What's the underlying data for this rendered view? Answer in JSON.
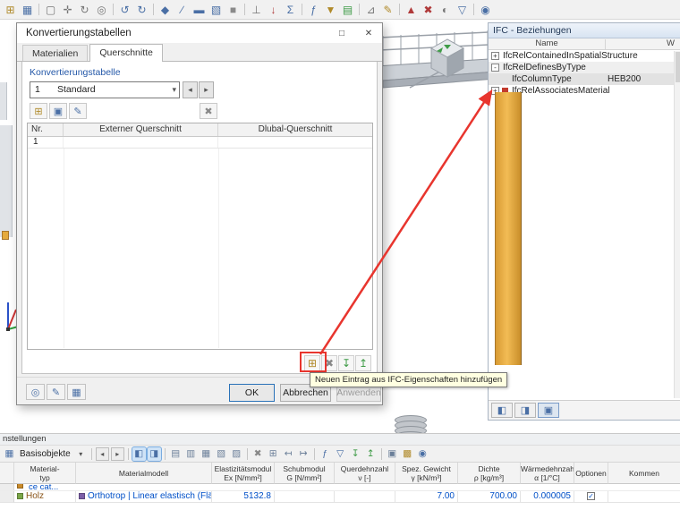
{
  "annotations": {
    "highlight_color": "#e8352e"
  },
  "colors": {
    "value_blue": "#0050c8",
    "column_orange": "#e9ab41",
    "material_chip": "#7aa648",
    "model_chip": "#7b5ea7",
    "partial_chip": "#c98a2a"
  },
  "top_toolbar": {
    "icons": [
      {
        "name": "new-model-icon",
        "glyph": "⊞",
        "color": "#b08a2a"
      },
      {
        "name": "open-model-icon",
        "glyph": "▦",
        "color": "#4a6fa5"
      },
      {
        "sep": true
      },
      {
        "name": "select-arrow-icon",
        "glyph": "▢",
        "color": "#777777"
      },
      {
        "name": "pan-icon",
        "glyph": "✛",
        "color": "#777777"
      },
      {
        "name": "rotate-view-icon",
        "glyph": "↻",
        "color": "#777777"
      },
      {
        "name": "zoom-view-icon",
        "glyph": "◎",
        "color": "#777777"
      },
      {
        "sep": true
      },
      {
        "name": "undo-icon",
        "glyph": "↺",
        "color": "#4a6fa5"
      },
      {
        "name": "redo-icon",
        "glyph": "↻",
        "color": "#4a6fa5"
      },
      {
        "sep": true
      },
      {
        "name": "node-tool-icon",
        "glyph": "◆",
        "color": "#4a6fa5"
      },
      {
        "name": "line-tool-icon",
        "glyph": "∕",
        "color": "#4a6fa5"
      },
      {
        "name": "member-tool-icon",
        "glyph": "▬",
        "color": "#4a6fa5"
      },
      {
        "name": "surface-tool-icon",
        "glyph": "▧",
        "color": "#4a6fa5"
      },
      {
        "name": "solid-tool-icon",
        "glyph": "■",
        "color": "#8a8a8a"
      },
      {
        "sep": true
      },
      {
        "name": "support-tool-icon",
        "glyph": "⊥",
        "color": "#777777"
      },
      {
        "name": "load-tool-icon",
        "glyph": "↓",
        "color": "#b03a3a"
      },
      {
        "name": "load-case-icon",
        "glyph": "Σ",
        "color": "#4a6fa5"
      },
      {
        "sep": true
      },
      {
        "name": "calculate-icon",
        "glyph": "ƒ",
        "color": "#4a6fa5"
      },
      {
        "name": "results-icon",
        "glyph": "▼",
        "color": "#b08a2a"
      },
      {
        "name": "tables-icon",
        "glyph": "▤",
        "color": "#3f9b47"
      },
      {
        "sep": true
      },
      {
        "name": "section-cut-icon",
        "glyph": "⊿",
        "color": "#777777"
      },
      {
        "name": "annotate-icon",
        "glyph": "✎",
        "color": "#b08a2a"
      },
      {
        "sep": true
      },
      {
        "name": "delete-load-icon",
        "glyph": "▲",
        "color": "#b03a3a"
      },
      {
        "name": "delete-icon",
        "glyph": "✖",
        "color": "#b03a3a"
      },
      {
        "name": "visibility-icon",
        "glyph": "◐",
        "color": "#777777"
      },
      {
        "name": "filter-icon",
        "glyph": "▽",
        "color": "#4a6fa5"
      },
      {
        "sep": true
      },
      {
        "name": "search-icon",
        "glyph": "◉",
        "color": "#4a6fa5"
      }
    ]
  },
  "dialog": {
    "title": "Konvertierungstabellen",
    "icons": {
      "maximize": "□",
      "close": "✕",
      "caret": "▾"
    },
    "tabs": [
      {
        "label": "Materialien",
        "active": false
      },
      {
        "label": "Querschnitte",
        "active": true
      }
    ],
    "group_label": "Konvertierungstabelle",
    "combo": {
      "index": "1",
      "value": "Standard"
    },
    "nav": {
      "prev": "◂",
      "next": "▸"
    },
    "table_toolbar": [
      {
        "name": "new-table-icon",
        "glyph": "⊞",
        "color": "#b08a2a"
      },
      {
        "name": "copy-table-icon",
        "glyph": "▣",
        "color": "#4a6fa5"
      },
      {
        "name": "rename-table-icon",
        "glyph": "✎",
        "color": "#4a6fa5"
      }
    ],
    "delete_table_icon": {
      "glyph": "✖",
      "color": "#888888"
    },
    "table": {
      "columns": [
        "Nr.",
        "Externer Querschnitt",
        "Dlubal-Querschnitt"
      ],
      "rows": [
        [
          "1",
          "",
          ""
        ]
      ]
    },
    "entry_buttons": [
      {
        "name": "add-from-ifc-button",
        "glyph": "⊞",
        "color": "#b08a2a"
      },
      {
        "name": "delete-entry-button",
        "glyph": "✖",
        "color": "#888888"
      },
      {
        "name": "import-entries-button",
        "glyph": "↧",
        "color": "#3f9b47"
      },
      {
        "name": "export-entries-button",
        "glyph": "↥",
        "color": "#3f9b47"
      }
    ],
    "tooltip": "Neuen Eintrag aus IFC-Eigenschaften hinzufügen",
    "footer_tools": [
      {
        "name": "details-icon",
        "glyph": "◎",
        "color": "#4a6fa5"
      },
      {
        "name": "edit-settings-icon",
        "glyph": "✎",
        "color": "#4a6fa5"
      },
      {
        "name": "manage-tables-icon",
        "glyph": "▦",
        "color": "#4a6fa5"
      }
    ],
    "footer_buttons": {
      "ok": "OK",
      "cancel": "Abbrechen",
      "apply": "Anwenden"
    }
  },
  "ifc_panel": {
    "title": "IFC - Beziehungen",
    "name_column": "Name",
    "value_column": "W",
    "rows": [
      {
        "expander": "+",
        "label": "IfcRelContainedInSpatialStructure",
        "value": ""
      },
      {
        "expander": "-",
        "label": "IfcRelDefinesByType",
        "value": ""
      },
      {
        "expander": "",
        "label": "IfcColumnType",
        "value": "HEB200"
      },
      {
        "expander": "+",
        "label": "IfcRelAssociatesMaterial",
        "value": ""
      }
    ]
  },
  "bottom_panel": {
    "strip_label": "nstellungen",
    "view_selector": {
      "label": "Basisobjekte",
      "caret": "▾",
      "prev": "◂",
      "next": "▸"
    },
    "toolbar_icons": [
      {
        "name": "table-toggle-left-icon",
        "glyph": "◧",
        "color": "#4a6fa5",
        "active": true
      },
      {
        "name": "table-toggle-right-icon",
        "glyph": "◨",
        "color": "#4a6fa5",
        "active": true
      },
      {
        "sep": true
      },
      {
        "name": "table-view-icon",
        "glyph": "▤",
        "color": "#6b7f99"
      },
      {
        "name": "table-columns-icon",
        "glyph": "▥",
        "color": "#6b7f99"
      },
      {
        "name": "table-grid-icon",
        "glyph": "▦",
        "color": "#6b7f99"
      },
      {
        "name": "table-hatch-icon",
        "glyph": "▧",
        "color": "#6b7f99"
      },
      {
        "name": "table-pattern-icon",
        "glyph": "▨",
        "color": "#6b7f99"
      },
      {
        "sep": true
      },
      {
        "name": "delete-row-icon",
        "glyph": "✖",
        "color": "#888888"
      },
      {
        "name": "insert-row-icon",
        "glyph": "⊞",
        "color": "#6b7f99"
      },
      {
        "name": "first-row-icon",
        "glyph": "↤",
        "color": "#6b7f99"
      },
      {
        "name": "last-row-icon",
        "glyph": "↦",
        "color": "#6b7f99"
      },
      {
        "sep": true
      },
      {
        "name": "formula-icon",
        "glyph": "ƒ",
        "color": "#4a6fa5"
      },
      {
        "name": "filter-rows-icon",
        "glyph": "▽",
        "color": "#4a6fa5"
      },
      {
        "name": "import-table-icon",
        "glyph": "↧",
        "color": "#3f9b47"
      },
      {
        "name": "export-table-icon",
        "glyph": "↥",
        "color": "#3f9b47"
      },
      {
        "sep": true
      },
      {
        "name": "print-table-icon",
        "glyph": "▣",
        "color": "#6b7f99"
      },
      {
        "name": "color-scale-icon",
        "glyph": "▩",
        "color": "#b08a2a"
      },
      {
        "name": "search-table-icon",
        "glyph": "◉",
        "color": "#4a6fa5"
      }
    ],
    "table": {
      "headers": [
        {
          "line1": "",
          "line2": ""
        },
        {
          "line1": "Material-",
          "line2": "typ"
        },
        {
          "line1": "Materialmodell",
          "line2": ""
        },
        {
          "line1": "Elastizitätsmodul",
          "line2": "Ex [N/mm²]"
        },
        {
          "line1": "Schubmodul",
          "line2": "G [N/mm²]"
        },
        {
          "line1": "Querdehnzahl",
          "line2": "ν [-]"
        },
        {
          "line1": "Spez. Gewicht",
          "line2": "γ [kN/m³]"
        },
        {
          "line1": "Dichte",
          "line2": "ρ [kg/m³]"
        },
        {
          "line1": "Wärmedehnzahl",
          "line2": "α [1/°C]"
        },
        {
          "line1": "Optionen",
          "line2": ""
        },
        {
          "line1": "Kommen",
          "line2": ""
        }
      ],
      "partial_row": {
        "label": "ce cat..."
      },
      "row": {
        "material": "Holz",
        "model": "Orthotrop | Linear elastisch (Fläc...",
        "e": "5132.8",
        "g": "",
        "nu": "",
        "gamma": "7.00",
        "rho": "700.00",
        "alpha": "0.000005",
        "options_glyph": "✓",
        "comment": ""
      }
    }
  }
}
